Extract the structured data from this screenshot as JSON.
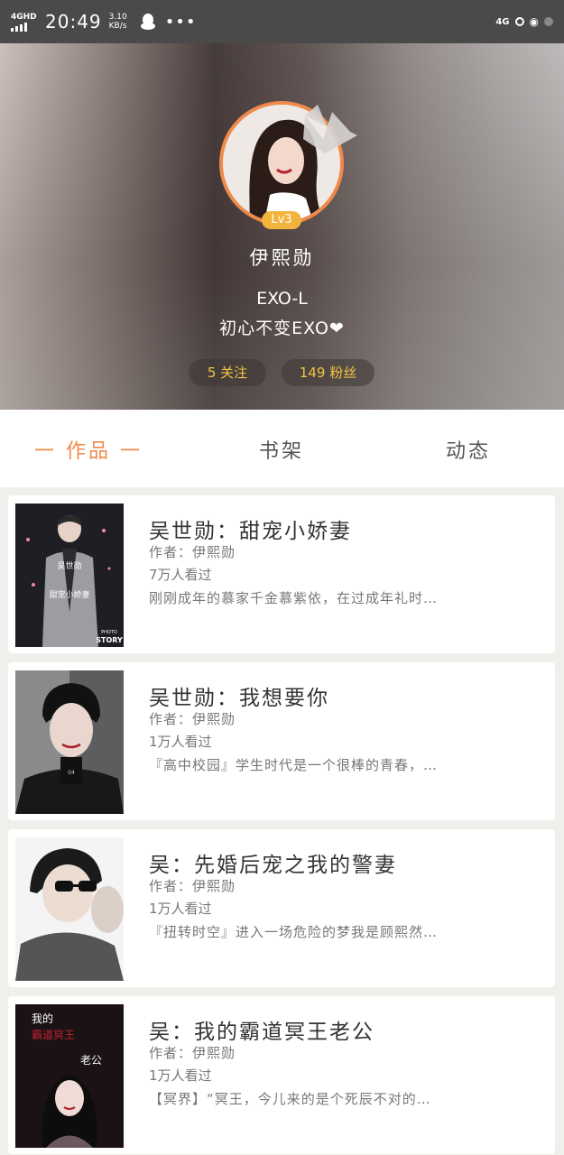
{
  "status_bar": {
    "network": "4GHD",
    "time": "20:49",
    "speed_value": "3.10",
    "speed_unit": "KB/s",
    "dots": "•••",
    "right_network": "4G"
  },
  "profile": {
    "level": "Lv3",
    "name": "伊熙勋",
    "bio_line1": "EXO-L",
    "bio_line2": "初心不变EXO❤",
    "following": "5 关注",
    "followers": "149 粉丝"
  },
  "tabs": [
    {
      "label": "一 作品 一",
      "active": true
    },
    {
      "label": "书架",
      "active": false
    },
    {
      "label": "动态",
      "active": false
    }
  ],
  "works": [
    {
      "title": "吴世勋：甜宠小娇妻",
      "author": "作者：伊熙勋",
      "views": "7万人看过",
      "desc": "刚刚成年的慕家千金慕紫依，在过成年礼时…"
    },
    {
      "title": "吴世勋：我想要你",
      "author": "作者：伊熙勋",
      "views": "1万人看过",
      "desc": "『高中校园』学生时代是一个很棒的青春，…"
    },
    {
      "title": "吴：先婚后宠之我的警妻",
      "author": "作者：伊熙勋",
      "views": "1万人看过",
      "desc": "『扭转时空』进入一场危险的梦我是顾熙然…"
    },
    {
      "title": "吴：我的霸道冥王老公",
      "author": "作者：伊熙勋",
      "views": "1万人看过",
      "desc": "【冥界】“冥王，今儿来的是个死辰不对的…"
    }
  ],
  "covers": {
    "c1_text1": "吴世勋",
    "c1_text2": "甜宠小娇妻",
    "c1_badge": "STORY",
    "c1_photo": "PHOTO",
    "c2_text": "04",
    "c4_text1": "我的",
    "c4_text2": "霸道冥王",
    "c4_text3": "老公"
  },
  "colors": {
    "accent": "#f08a4b",
    "level_badge": "#f3b43d",
    "pill_text": "#f5c542"
  }
}
